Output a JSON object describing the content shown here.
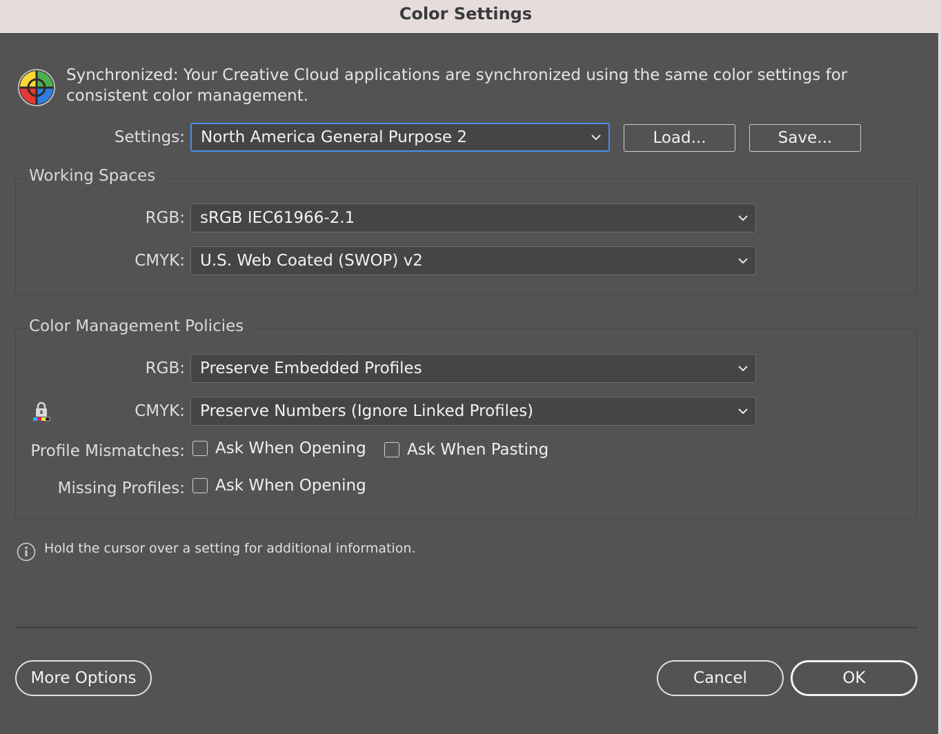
{
  "window": {
    "title": "Color Settings"
  },
  "sync": {
    "icon": "color-wheel-sync-icon",
    "message": "Synchronized: Your Creative Cloud applications are synchronized using the same color settings for consistent color management."
  },
  "settings": {
    "label": "Settings:",
    "value": "North America General Purpose 2",
    "load_label": "Load...",
    "save_label": "Save..."
  },
  "working_spaces": {
    "title": "Working Spaces",
    "rgb_label": "RGB:",
    "rgb_value": "sRGB IEC61966-2.1",
    "cmyk_label": "CMYK:",
    "cmyk_value": "U.S. Web Coated (SWOP) v2"
  },
  "policies": {
    "title": "Color Management Policies",
    "rgb_label": "RGB:",
    "rgb_value": "Preserve Embedded Profiles",
    "cmyk_label": "CMYK:",
    "cmyk_value": "Preserve Numbers (Ignore Linked Profiles)",
    "mismatch_label": "Profile Mismatches:",
    "mismatch_opening_label": "Ask When Opening",
    "mismatch_opening_checked": false,
    "mismatch_pasting_label": "Ask When Pasting",
    "mismatch_pasting_checked": false,
    "missing_label": "Missing Profiles:",
    "missing_opening_label": "Ask When Opening",
    "missing_opening_checked": false
  },
  "info": {
    "text": "Hold the cursor over a setting for additional information."
  },
  "footer": {
    "more_options_label": "More Options",
    "cancel_label": "Cancel",
    "ok_label": "OK"
  },
  "colors": {
    "window_bg": "#535353",
    "titlebar_bg": "#e6dcdc",
    "focus_ring": "#4c8ee8"
  }
}
